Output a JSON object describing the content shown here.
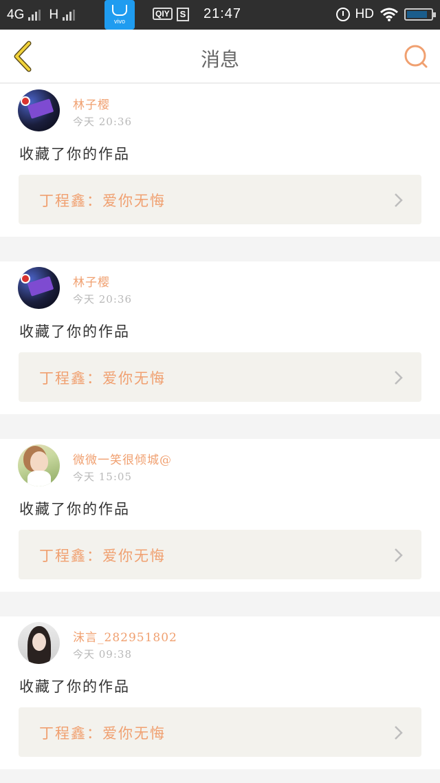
{
  "status_bar": {
    "network_1": "4G",
    "network_2": "H",
    "vivo_label": "vivo",
    "iqiyi_label": "QIY",
    "s_label": "S",
    "clock": "21:47",
    "hd_label": "HD",
    "battery_level": 0.85
  },
  "header": {
    "title": "消息",
    "accent_color": "#f0a070"
  },
  "messages": [
    {
      "name": "林子樱",
      "time": "今天 20:36",
      "action": "收藏了你的作品",
      "work": "丁程鑫：爱你无悔",
      "avatar": "purple-sign-photo"
    },
    {
      "name": "林子樱",
      "time": "今天 20:36",
      "action": "收藏了你的作品",
      "work": "丁程鑫：爱你无悔",
      "avatar": "purple-sign-photo"
    },
    {
      "name": "微微一笑很倾城@",
      "time": "今天 15:05",
      "action": "收藏了你的作品",
      "work": "丁程鑫：爱你无悔",
      "avatar": "girl-outdoor-photo"
    },
    {
      "name": "沫言_282951802",
      "time": "今天 09:38",
      "action": "收藏了你的作品",
      "work": "丁程鑫：爱你无悔",
      "avatar": "girl-portrait-photo"
    }
  ]
}
